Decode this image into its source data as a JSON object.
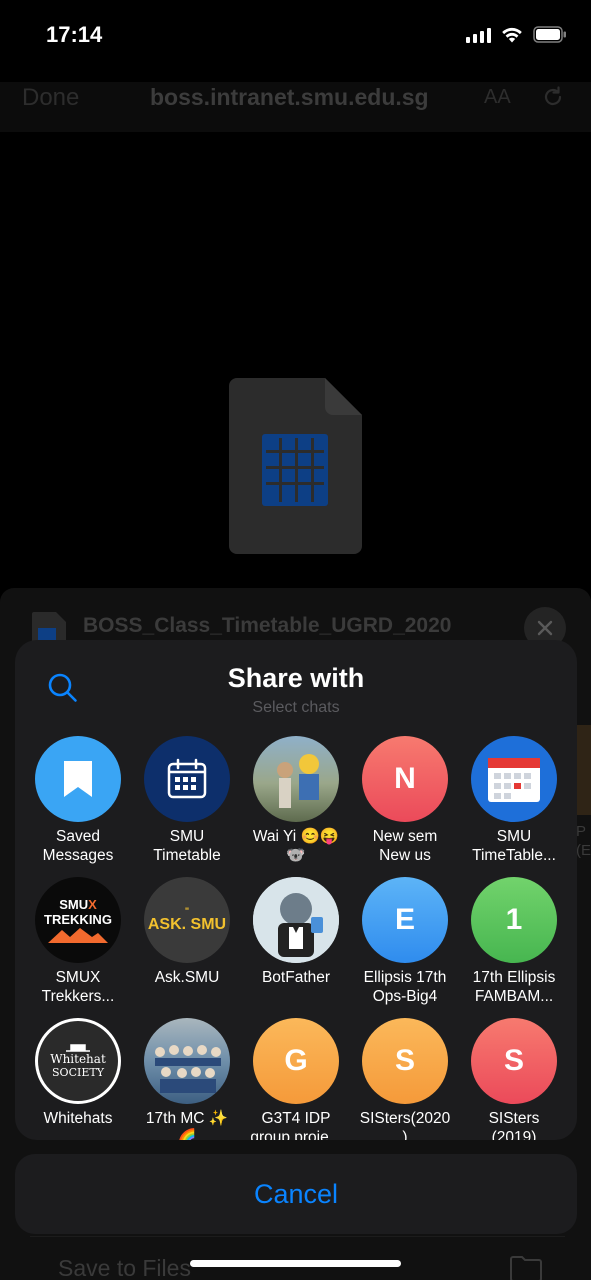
{
  "status_bar": {
    "time": "17:14"
  },
  "browser": {
    "done_label": "Done",
    "url": "boss.intranet.smu.edu.sg",
    "text_size_label": "AA"
  },
  "file": {
    "name": "BOSS_Class_Timetable_UGRD_2020"
  },
  "save_to_files_label": "Save to Files",
  "side_peek": {
    "text_top": "P",
    "text_bottom": "(E"
  },
  "share": {
    "title": "Share with",
    "subtitle": "Select chats",
    "chats": [
      {
        "name": "Saved\nMessages",
        "avatar": "bookmark-icon",
        "color": "#39a4f5"
      },
      {
        "name": "SMU\nTimetable",
        "avatar": "calendar-icon",
        "color": "#0d2f6b"
      },
      {
        "name": "Wai Yi 😊😝\n🐨",
        "avatar": "photo",
        "color": "#7b8a6e"
      },
      {
        "name": "New sem\nNew us",
        "avatar": "N",
        "color": "#f0525a"
      },
      {
        "name": "SMU\nTimeTable...",
        "avatar": "calendar-red-icon",
        "color": "#1e6fd9"
      },
      {
        "name": "SMUX\nTrekkers...",
        "avatar": "SMUX TREKKING",
        "color": "#0a0a0a"
      },
      {
        "name": "Ask.SMU",
        "avatar": "ASK. SMU",
        "color": "#3a3a3a"
      },
      {
        "name": "BotFather",
        "avatar": "botfather",
        "color": "#d8e4ea"
      },
      {
        "name": "Ellipsis 17th\nOps-Big4",
        "avatar": "E",
        "color": "#3d9cf0"
      },
      {
        "name": "17th Ellipsis\nFAMBAM...",
        "avatar": "1",
        "color": "#54c25a"
      },
      {
        "name": "Whitehats",
        "avatar": "Whitehat SOCIETY",
        "color": "#2a2a2a"
      },
      {
        "name": "17th MC ✨\n🌈",
        "avatar": "group-photo",
        "color": "#5a7d9a"
      },
      {
        "name": "G3T4 IDP\ngroup proje...",
        "avatar": "G",
        "color": "#f9a546"
      },
      {
        "name": "SISters(2020\n)",
        "avatar": "S",
        "color": "#f9a546"
      },
      {
        "name": "SISters\n(2019)",
        "avatar": "S",
        "color": "#f0525a"
      }
    ]
  },
  "cancel_label": "Cancel",
  "colors": {
    "accent": "#0a84ff",
    "panel": "#1c1c1e"
  }
}
